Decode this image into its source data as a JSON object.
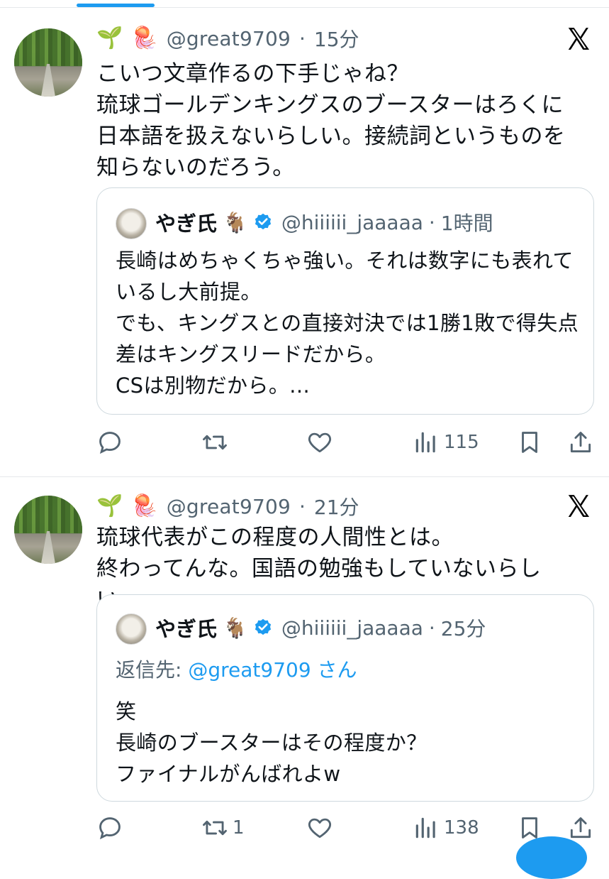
{
  "colors": {
    "accent": "#1d9bf0",
    "muted": "#536471",
    "text": "#0f1419",
    "border": "#cfd9de"
  },
  "tweets": [
    {
      "emoji": [
        "🌱",
        "🪼"
      ],
      "handle": "@great9709",
      "separator": "·",
      "time": "15分",
      "text": "こいつ文章作るの下手じゃね？\n琉球ゴールデンキングスのブースターはろくに日本語を扱えないらしい。接続詞というものを知らないのだろう。",
      "quote": {
        "name": "やぎ氏",
        "name_emoji": "🐐",
        "handle": "@hiiiiii_jaaaaa",
        "separator": "·",
        "time": "1時間",
        "text": "長崎はめちゃくちゃ強い。それは数字にも表れているし大前提。\nでも、キングスとの直接対決では1勝1敗で得失点差はキングスリードだから。\nCSは別物だから。..."
      },
      "actions": {
        "reply_count": "",
        "retweet_count": "",
        "like_count": "",
        "view_count": "115"
      }
    },
    {
      "emoji": [
        "🌱",
        "🪼"
      ],
      "handle": "@great9709",
      "separator": "·",
      "time": "21分",
      "text": "琉球代表がこの程度の人間性とは。\n終わってんな。国語の勉強もしていないらしい。",
      "quote": {
        "name": "やぎ氏",
        "name_emoji": "🐐",
        "handle": "@hiiiiii_jaaaaa",
        "separator": "·",
        "time": "25分",
        "reply_prefix": "返信先:",
        "reply_mention": "@great9709",
        "reply_suffix": "さん",
        "text": "笑\n長崎のブースターはその程度か？\nファイナルがんばれよw"
      },
      "actions": {
        "reply_count": "",
        "retweet_count": "1",
        "like_count": "",
        "view_count": "138"
      }
    }
  ]
}
